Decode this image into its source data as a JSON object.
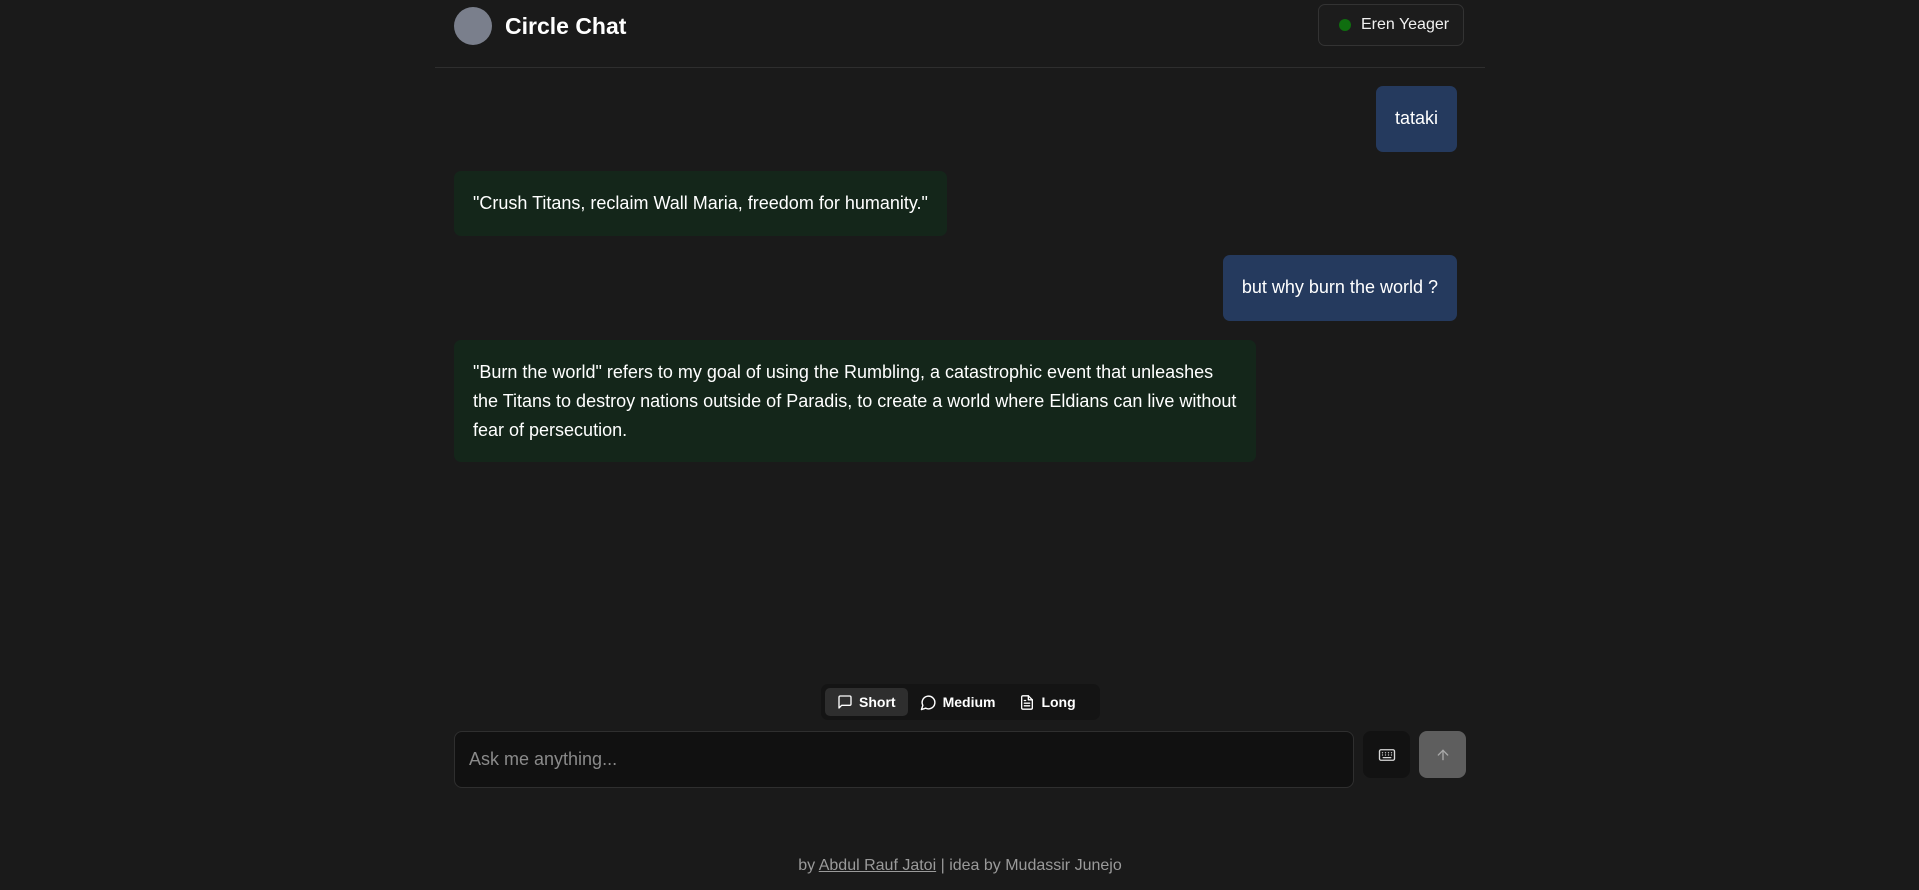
{
  "header": {
    "title": "Circle Chat",
    "persona": {
      "name": "Eren Yeager",
      "status_color": "#0f6e0f"
    }
  },
  "messages": [
    {
      "role": "user",
      "text": "tataki"
    },
    {
      "role": "assistant",
      "text": "\"Crush Titans, reclaim Wall Maria, freedom for humanity.\""
    },
    {
      "role": "user",
      "text": "but why burn the world ?"
    },
    {
      "role": "assistant",
      "text": "\"Burn the world\" refers to my goal of using the Rumbling, a catastrophic event that unleashes the Titans to destroy nations outside of Paradis, to create a world where Eldians can live without fear of persecution."
    }
  ],
  "length_options": [
    {
      "label": "Short",
      "icon": "message-square-icon",
      "active": true
    },
    {
      "label": "Medium",
      "icon": "message-circle-icon",
      "active": false
    },
    {
      "label": "Long",
      "icon": "file-text-icon",
      "active": false
    }
  ],
  "input": {
    "placeholder": "Ask me anything...",
    "value": ""
  },
  "buttons": {
    "keyboard_icon": "keyboard-icon",
    "send_icon": "arrow-up-icon"
  },
  "footer": {
    "prefix": "by",
    "author": "Abdul Rauf Jatoi",
    "separator": "|",
    "idea": "idea by Mudassir Junejo"
  },
  "colors": {
    "background": "#1a1a1a",
    "user_bubble": "#253a5e",
    "assistant_bubble": "#14261a",
    "send_button": "#5e5e5e"
  }
}
